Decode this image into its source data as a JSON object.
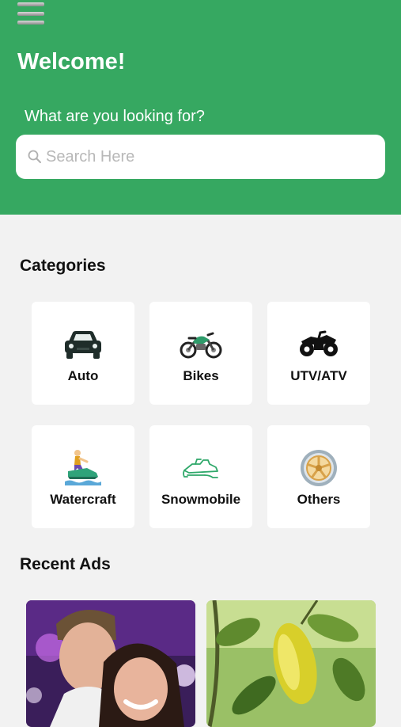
{
  "header": {
    "title": "Welcome!",
    "prompt": "What are you looking for?",
    "menu_icon": "hamburger-menu-icon",
    "bg_color": "#36a861"
  },
  "search": {
    "placeholder": "Search Here",
    "icon": "search-icon"
  },
  "categories": {
    "title": "Categories",
    "items": [
      {
        "label": "Auto",
        "icon": "car-icon"
      },
      {
        "label": "Bikes",
        "icon": "motorcycle-icon"
      },
      {
        "label": "UTV/ATV",
        "icon": "atv-icon"
      },
      {
        "label": "Watercraft",
        "icon": "jet-ski-icon"
      },
      {
        "label": "Snowmobile",
        "icon": "snowmobile-icon"
      },
      {
        "label": "Others",
        "icon": "wheel-icon"
      }
    ]
  },
  "recent_ads": {
    "title": "Recent Ads",
    "items": [
      {
        "image": "photo-of-two-people"
      },
      {
        "image": "photo-of-lemon-tree"
      }
    ]
  }
}
